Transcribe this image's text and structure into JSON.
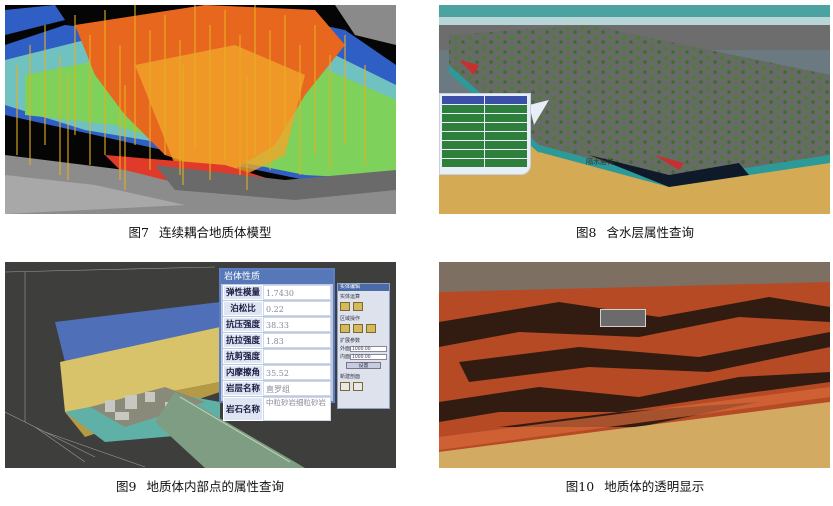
{
  "figures": [
    {
      "id": "fig7",
      "number": "图7",
      "caption": "连续耦合地质体模型"
    },
    {
      "id": "fig8",
      "number": "图8",
      "caption": "含水层属性查询"
    },
    {
      "id": "fig9",
      "number": "图9",
      "caption": "地质体内部点的属性查询"
    },
    {
      "id": "fig10",
      "number": "图10",
      "caption": "地质体的透明显示"
    }
  ],
  "fig8": {
    "inline_label": "隔水层体"
  },
  "fig9": {
    "panel_title": "岩体性质",
    "properties": [
      {
        "label": "弹性模量",
        "value": "1.7430"
      },
      {
        "label": "泊松比",
        "value": "0.22"
      },
      {
        "label": "抗压强度",
        "value": "38.33"
      },
      {
        "label": "抗拉强度",
        "value": "1.83"
      },
      {
        "label": "抗剪强度",
        "value": ""
      },
      {
        "label": "内摩擦角",
        "value": "35.52"
      },
      {
        "label": "岩层名称",
        "value": "直罗组"
      },
      {
        "label": "岩石名称",
        "value": "中粒砂岩细粒砂岩"
      }
    ],
    "tool_panel": {
      "title": "实体编辑",
      "section1": "实体运算",
      "section2": "区域操作",
      "section3": "扩展参数",
      "field1_label": "外面",
      "field1_value": "1000.00",
      "field2_label": "内面",
      "field2_value": "1000.00",
      "set_button": "设置",
      "section4": "新建剖面"
    }
  },
  "colors": {
    "fig7_orange": "#e8671e",
    "fig7_green": "#7ed15a",
    "fig7_blue": "#2f5fc4",
    "fig8_teal": "#4aa3a0",
    "fig8_sand": "#d4aa55",
    "fig10_red": "#b64a24"
  }
}
